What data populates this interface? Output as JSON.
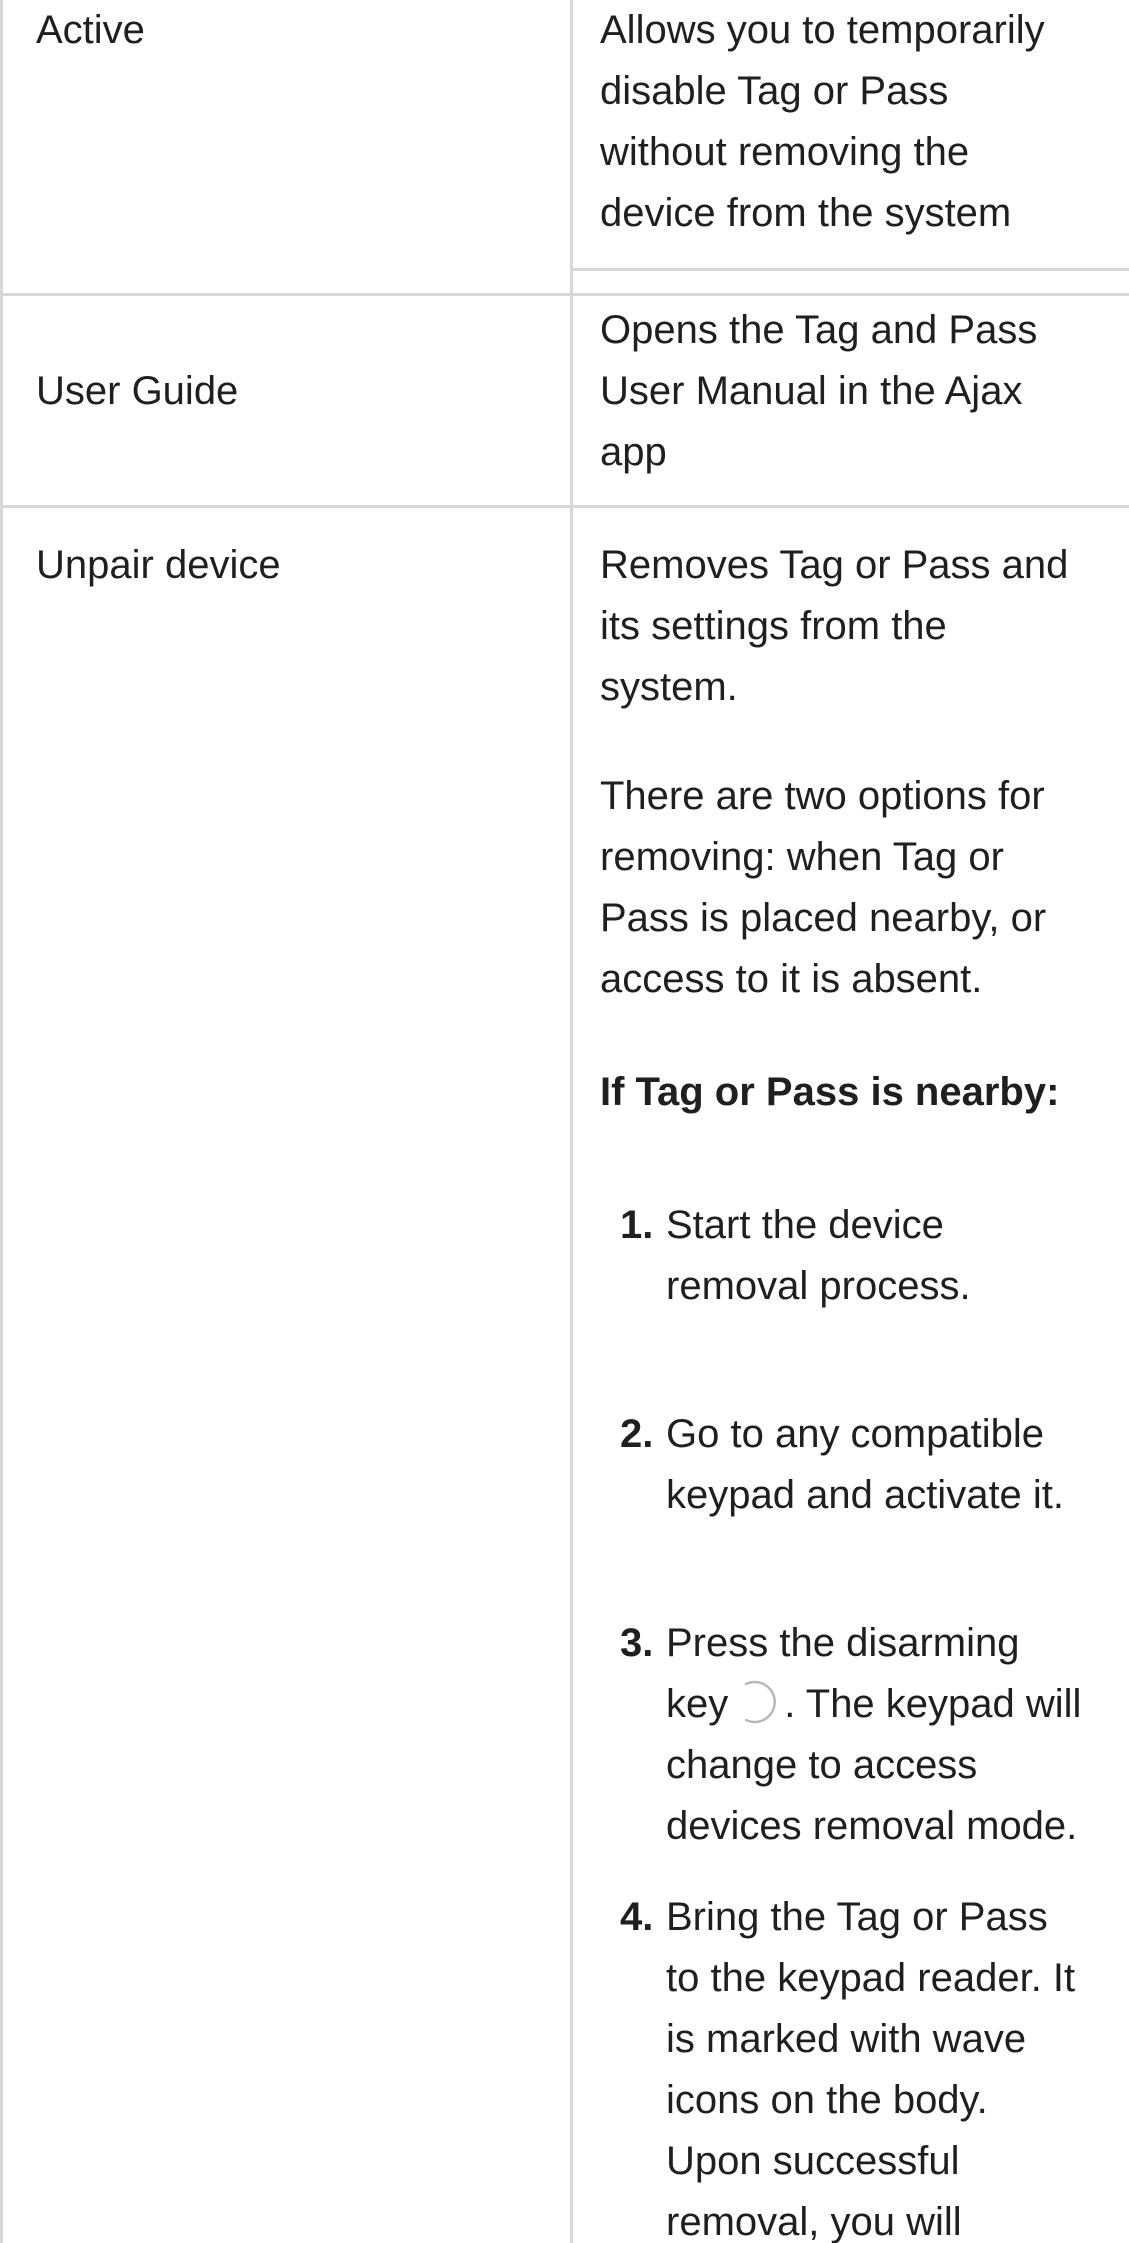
{
  "rows": [
    {
      "setting": "Active",
      "description": [
        "Allows you to temporarily",
        "disable Tag or Pass",
        "without removing the",
        "device from the system"
      ]
    },
    {
      "setting": "User Guide",
      "description": [
        "Opens the Tag and Pass",
        "User Manual in the Ajax",
        "app"
      ]
    },
    {
      "setting": "Unpair device",
      "description_lines_1": [
        "Removes Tag or Pass and",
        "its settings from the",
        "system."
      ],
      "description_lines_2": [
        "There are two options for",
        "removing: when Tag or",
        "Pass is placed nearby, or",
        "access to it is absent."
      ],
      "subheading": "If Tag or Pass is nearby:",
      "steps": [
        {
          "num": "1.",
          "lines": [
            "Start the device",
            "removal process."
          ]
        },
        {
          "num": "2.",
          "lines": [
            "Go to any compatible",
            "keypad and activate it."
          ]
        },
        {
          "num": "3.",
          "line1_before": "Press the disarming",
          "line2_before": "key",
          "line2_after": ". The keypad will",
          "lines_rest": [
            "change to access",
            "devices removal mode."
          ]
        },
        {
          "num": "4.",
          "lines": [
            "Bring the Tag or Pass",
            "to the keypad reader. It",
            "is marked with wave",
            "icons on the body.",
            "Upon successful",
            "removal, you will"
          ]
        }
      ]
    }
  ],
  "icons": {
    "disarm_key": "disarm-key-icon"
  },
  "colors": {
    "text": "#1f1f1f",
    "grid": "#d7d7d7"
  }
}
